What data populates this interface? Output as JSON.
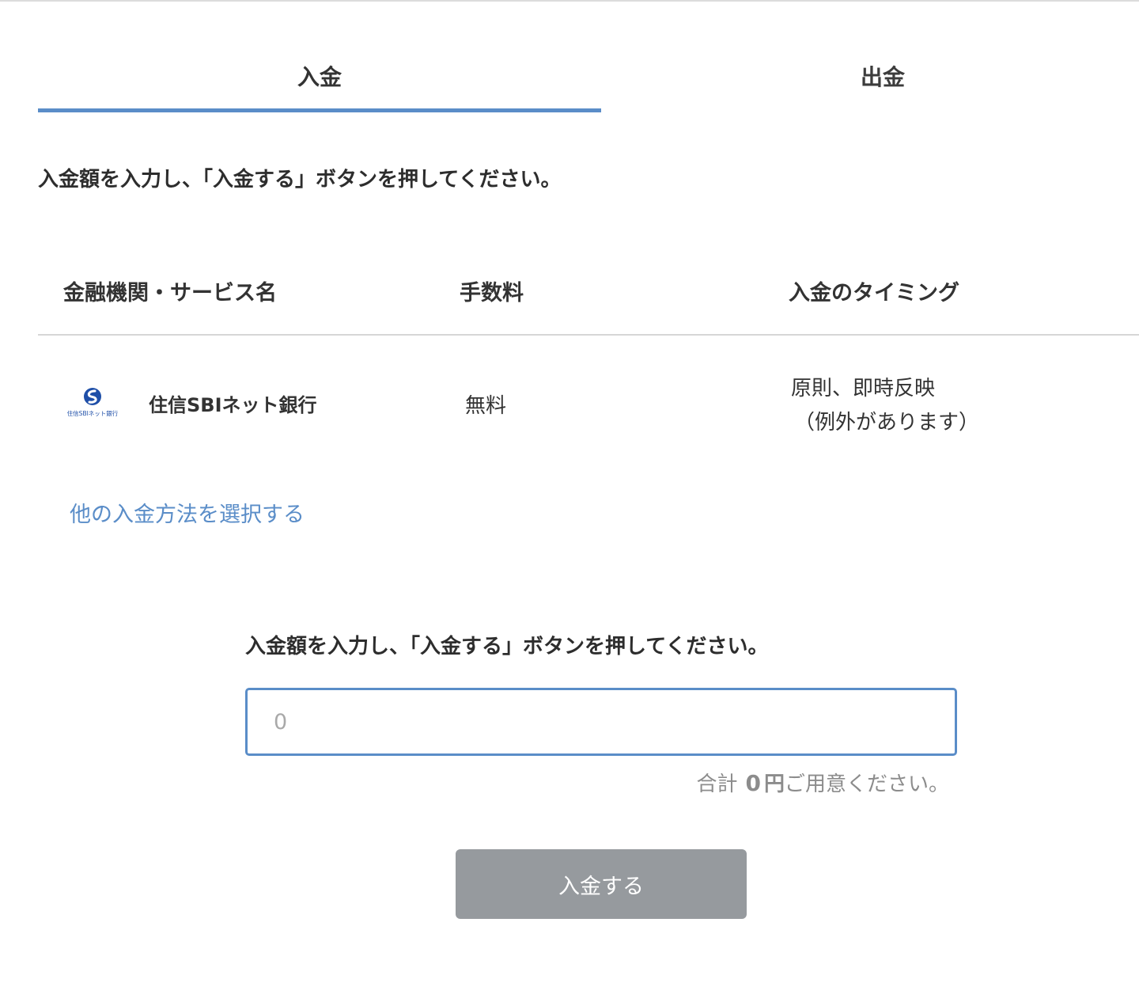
{
  "tabs": {
    "deposit_label": "入金",
    "withdraw_label": "出金"
  },
  "instruction": "入金額を入力し、「入金する」ボタンを押してください。",
  "table": {
    "headers": {
      "name": "金融機関・サービス名",
      "fee": "手数料",
      "timing": "入金のタイミング"
    },
    "row": {
      "logo_text": "住信SBIネット銀行",
      "bank_name": "住信SBIネット銀行",
      "fee": "無料",
      "timing_line1": "原則、即時反映",
      "timing_line2": "（例外があります）"
    }
  },
  "other_method_link": "他の入金方法を選択する",
  "form": {
    "instruction": "入金額を入力し、「入金する」ボタンを押してください。",
    "amount_placeholder": "0",
    "total_prefix": "合計",
    "total_amount": "0",
    "total_unit": "円",
    "total_suffix": "ご用意ください。",
    "submit_label": "入金する"
  },
  "colors": {
    "accent": "#5a8dc8",
    "button_disabled": "#969a9e",
    "logo_blue": "#1f4fa8"
  }
}
